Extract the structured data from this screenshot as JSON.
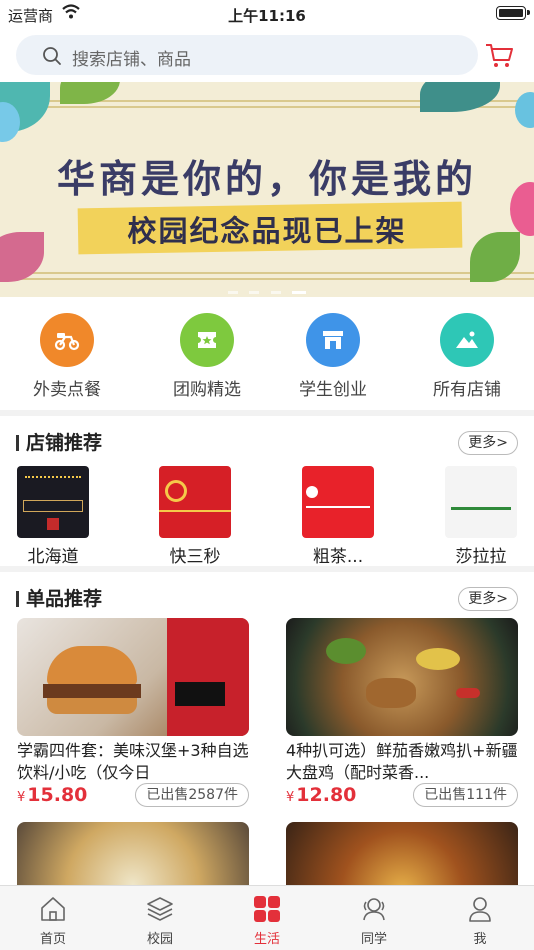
{
  "status_bar": {
    "carrier": "运营商",
    "time": "上午11:16"
  },
  "search": {
    "placeholder": "搜索店铺、商品"
  },
  "banner": {
    "headline": "华商是你的，你是我的",
    "subline": "校园纪念品现已上架"
  },
  "categories": [
    {
      "label": "外卖点餐",
      "icon": "scooter-icon",
      "color": "#f0882a"
    },
    {
      "label": "团购精选",
      "icon": "ticket-icon",
      "color": "#7ec93e"
    },
    {
      "label": "学生创业",
      "icon": "shop-icon",
      "color": "#3f94e8"
    },
    {
      "label": "所有店铺",
      "icon": "mountain-icon",
      "color": "#2ec7b6"
    }
  ],
  "stores_section": {
    "title": "店铺推荐",
    "more": "更多>",
    "stores": [
      {
        "name": "北海道"
      },
      {
        "name": "快三秒"
      },
      {
        "name": "粗茶..."
      },
      {
        "name": "莎拉拉"
      }
    ]
  },
  "products_section": {
    "title": "单品推荐",
    "more": "更多>",
    "products": [
      {
        "title": "学霸四件套：美味汉堡+3种自选饮料/小吃（仅今日",
        "currency": "¥",
        "price": "15.80",
        "sold": "已出售2587件"
      },
      {
        "title": "4种扒可选）鲜茄香嫩鸡扒+新疆大盘鸡（配时菜香...",
        "currency": "¥",
        "price": "12.80",
        "sold": "已出售111件"
      }
    ]
  },
  "tabs": [
    {
      "label": "首页",
      "icon": "home-icon"
    },
    {
      "label": "校园",
      "icon": "layers-icon"
    },
    {
      "label": "生活",
      "icon": "grid-icon",
      "active": true
    },
    {
      "label": "同学",
      "icon": "classmates-icon"
    },
    {
      "label": "我",
      "icon": "profile-icon"
    }
  ],
  "colors": {
    "accent": "#e3303a"
  }
}
